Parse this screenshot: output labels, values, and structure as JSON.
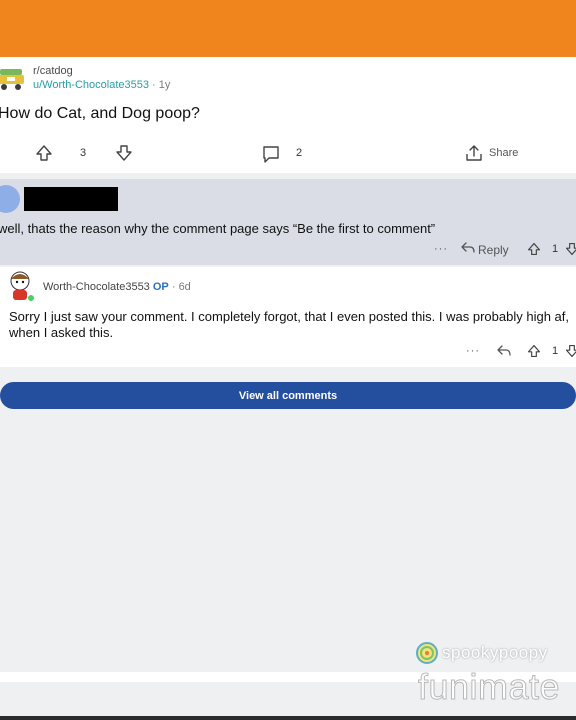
{
  "post": {
    "subreddit": "r/catdog",
    "author": "u/Worth-Chocolate3553",
    "separator": " · ",
    "age": "1y",
    "title": "How do Cat, and Dog poop?",
    "vote_count": "3",
    "comment_count": "2",
    "share_label": "Share"
  },
  "comments": [
    {
      "text": "well, thats the reason why the comment page says “Be the first to comment”",
      "more_label": "···",
      "reply_label": "Reply",
      "vote_count": "1"
    },
    {
      "author": "Worth-Chocolate3553",
      "op_label": "OP",
      "separator": " · ",
      "age": "6d",
      "text": "Sorry I just saw your comment. I completely forgot, that I even posted this. I was probably high af, when I asked this.",
      "more_label": "···",
      "vote_count": "1"
    }
  ],
  "view_all_label": "View all comments",
  "watermark": {
    "creator": "spookypoopy",
    "app": "funimate"
  },
  "colors": {
    "topbar": "#f0851e",
    "button": "#244f9f",
    "username": "#24a0a8",
    "op_badge": "#2b6fc9"
  }
}
